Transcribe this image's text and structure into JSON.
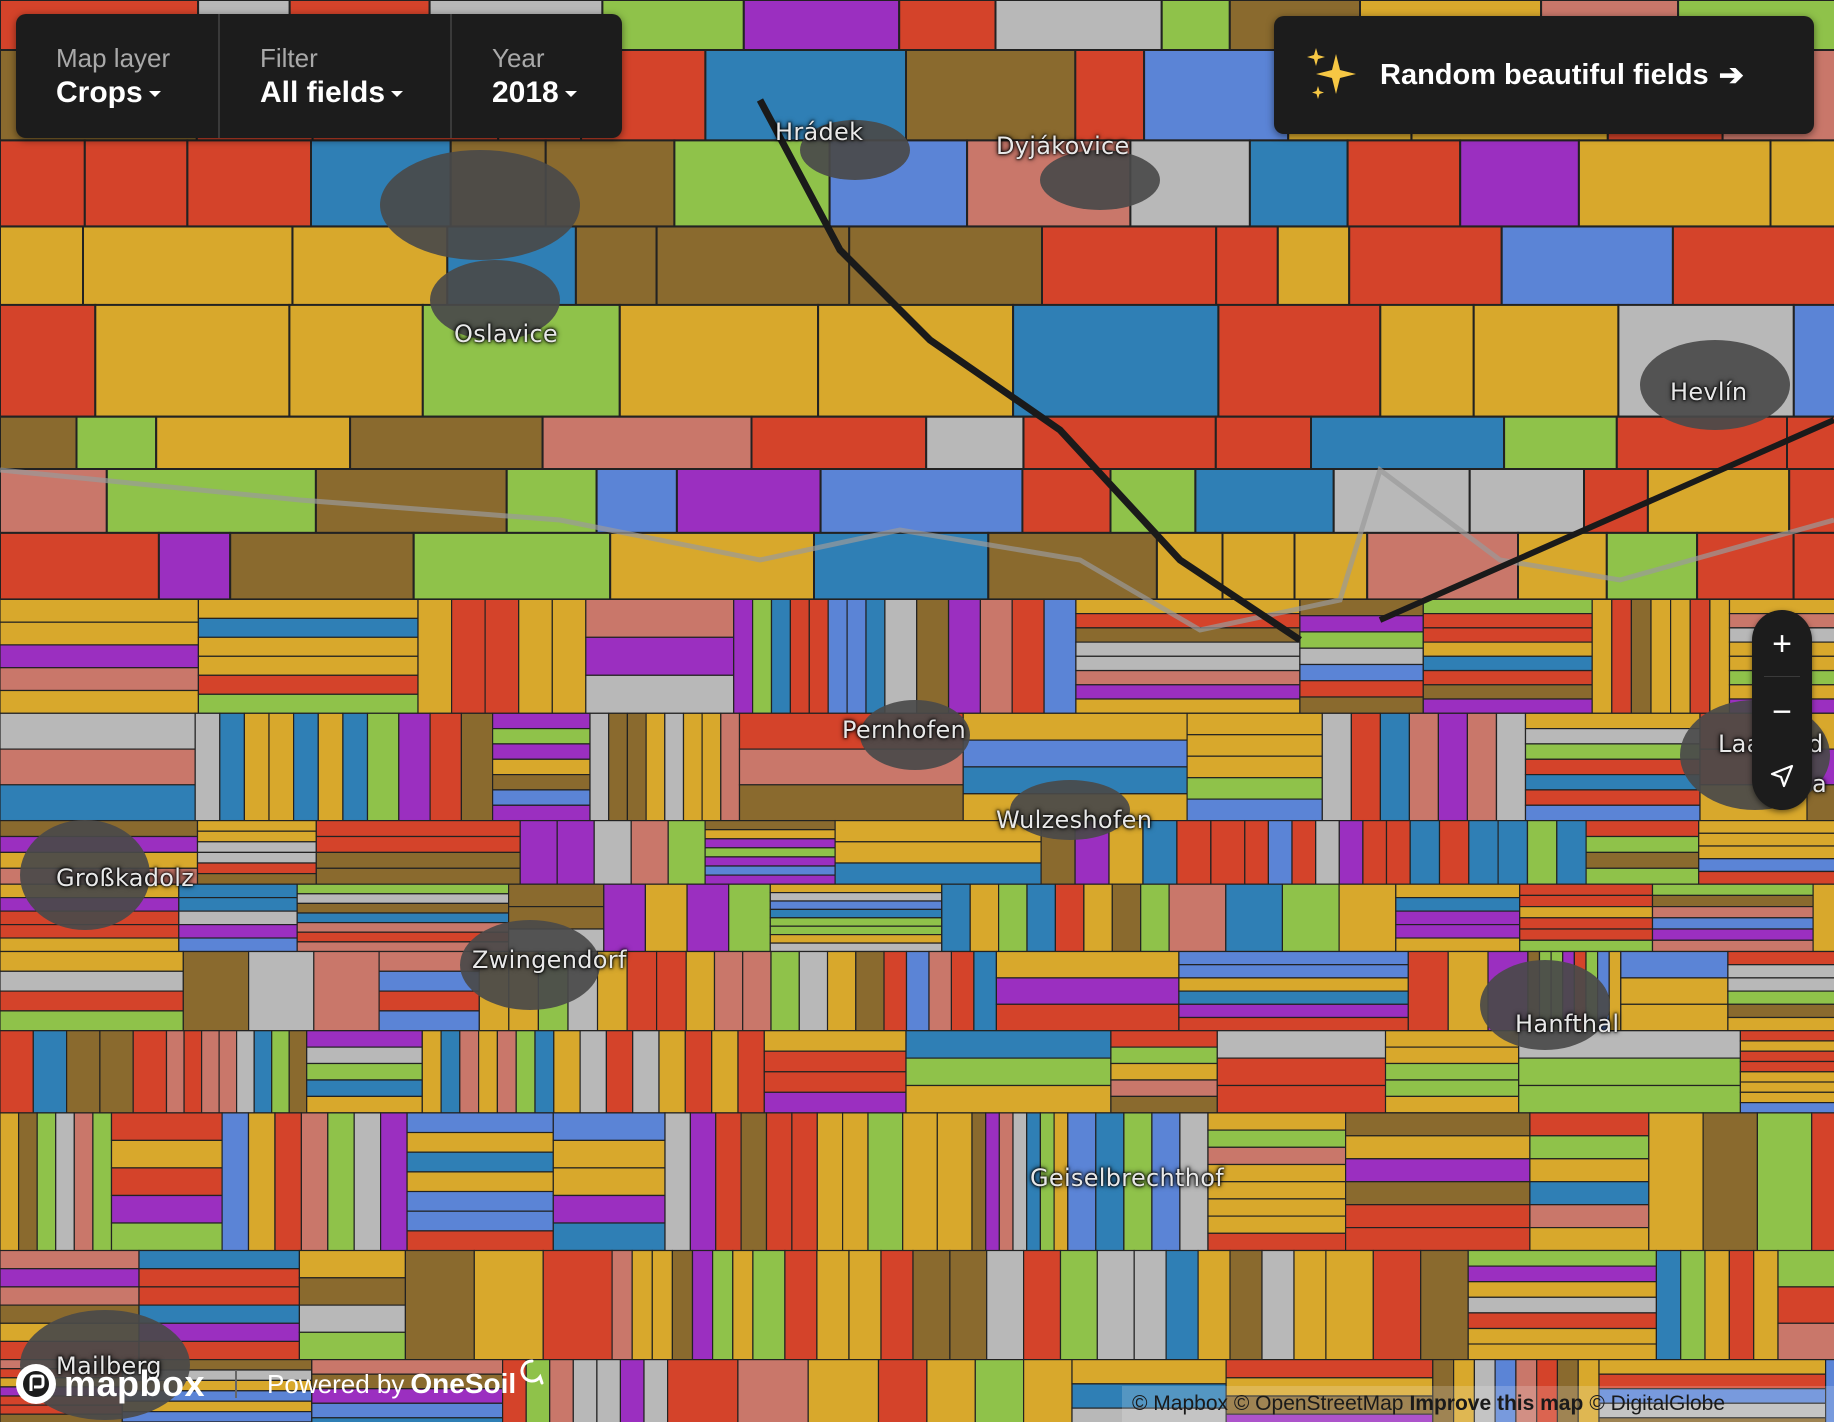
{
  "controls": {
    "map_layer": {
      "caption": "Map layer",
      "value": "Crops"
    },
    "filter": {
      "caption": "Filter",
      "value": "All fields"
    },
    "year": {
      "caption": "Year",
      "value": "2018"
    }
  },
  "random_button": {
    "icon": "sparkles-icon",
    "label": "Random beautiful fields",
    "arrow": "➔"
  },
  "place_labels": {
    "hradek": "Hrádek",
    "dyjakovice": "Dyjákovice",
    "oslavice": "Oslavice",
    "hevlin": "Hevlín",
    "pernhofen": "Pernhofen",
    "wulzeshofen": "Wulzeshofen",
    "grosskadolz": "Großkadolz",
    "zwingendorf": "Zwingendorf",
    "hanfthal": "Hanfthal",
    "geiselbrechthof": "Geiselbrechthof",
    "laa_a": "Laa an d",
    "laa_b": "a",
    "mailberg": "Mailberg"
  },
  "zoom": {
    "in": "+",
    "out": "−",
    "compass": "compass-icon"
  },
  "footer": {
    "mapbox_logo": "mapbox",
    "powered_by": "Powered by",
    "onesoil": "OneSoil"
  },
  "attribution": {
    "mapbox": "© Mapbox",
    "osm": "© OpenStreetMap",
    "improve": "Improve this map",
    "digitalglobe": "© DigitalGlobe"
  },
  "colors": {
    "wheat_yellow": "#d8a82c",
    "rapeseed_red": "#d4432a",
    "sunflower_blue": "#5b84d6",
    "corn_teal": "#2f7fb5",
    "barley_green": "#8fc24a",
    "fallow_gray": "#b8b8b8",
    "legume_purple": "#9b2fc0",
    "panel_bg": "#1c1c1c"
  }
}
